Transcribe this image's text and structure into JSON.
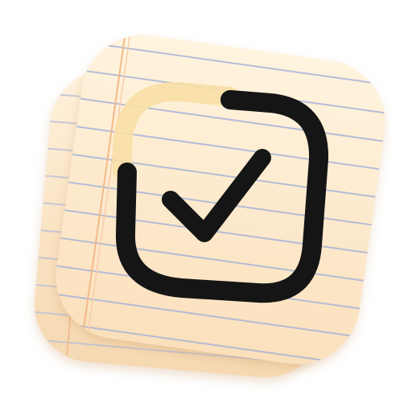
{
  "app_icon": {
    "icon_name": "checklist-notepad-icon",
    "colors": {
      "paper_top": "#FFF3DE",
      "paper_bottom": "#FCE3BF",
      "back_paper_top": "#FFF0DA",
      "back_paper_bottom": "#F8DDB8",
      "ruled_line": "#A9B4D8",
      "margin_line": "#F2B98A",
      "checkbox_stroke": "#151515",
      "checkbox_highlight": "#F9DFA6"
    }
  }
}
